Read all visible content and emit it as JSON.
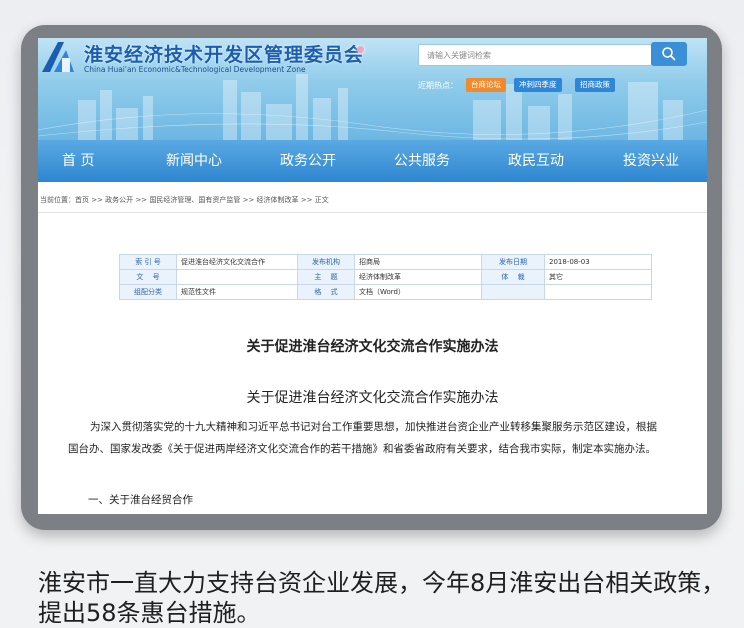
{
  "header": {
    "site_title": "淮安经济技术开发区管理委员会",
    "site_subtitle": "China Huai'an Economic&Technological Development Zone",
    "search_placeholder": "请输入关键词检索",
    "hot_label": "近期热点：",
    "hot_tags": [
      {
        "label": "台商论坛",
        "color": "#f08a2c"
      },
      {
        "label": "冲刺四季度",
        "color": "#2f86d6"
      },
      {
        "label": "招商政策",
        "color": "#2f86d6"
      }
    ]
  },
  "nav": {
    "items": [
      "首 页",
      "新闻中心",
      "政务公开",
      "公共服务",
      "政民互动",
      "投资兴业"
    ]
  },
  "breadcrumb": "当前位置：首页 >> 政务公开 >> 国民经济管理、国有资产监管 >> 经济体制改革 >> 正文",
  "meta": {
    "index_key": "索 引 号",
    "index_val": "促进淮台经济文化交流合作",
    "org_key": "发布机构",
    "org_val": "招商局",
    "date_key": "发布日期",
    "date_val": "2018-08-03",
    "docno_key": "文　 号",
    "docno_val": "",
    "subject_key": "主　 题",
    "subject_val": "经济体制改革",
    "genre_key": "体　 裁",
    "genre_val": "其它",
    "category_key": "组配分类",
    "category_val": "规范性文件",
    "format_key": "格　 式",
    "format_val": "文档（Word）",
    "blank_key": "",
    "blank_val": ""
  },
  "document": {
    "title_main": "关于促进淮台经济文化交流合作实施办法",
    "title_body": "关于促进淮台经济文化交流合作实施办法",
    "paragraph": "为深入贯彻落实党的十九大精神和习近平总书记对台工作重要思想，加快推进台资企业产业转移集聚服务示范区建设，根据国台办、国家发改委《关于促进两岸经济文化交流合作的若干措施》和省委省政府有关要求，结合我市实际，制定本实施办法。",
    "section1": "一、关于淮台经贸合作"
  },
  "caption": "淮安市一直大力支持台资企业发展，今年8月淮安出台相关政策，提出58条惠台措施。"
}
